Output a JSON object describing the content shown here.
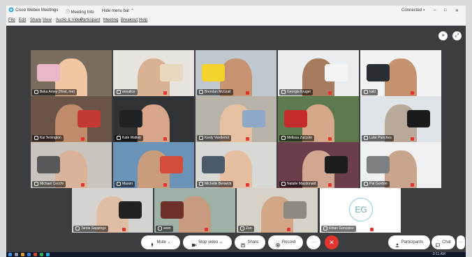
{
  "titlebar": {
    "app_title": "Cisco Webex Meetings",
    "meeting_info": "Meeting Info",
    "hide_menu_bar": "Hide menu bar",
    "status": "Connected",
    "minimize": "–",
    "maximize": "□",
    "close": "✕"
  },
  "menubar": [
    "File",
    "Edit",
    "Share",
    "View",
    "Audio & Video",
    "Participant",
    "Meeting",
    "Breakout",
    "Help"
  ],
  "participants": [
    {
      "name": "Beka Amey (Host, me)",
      "avatar": ""
    },
    {
      "name": "annalice",
      "avatar": ""
    },
    {
      "name": "Brendan McGrail",
      "avatar": ""
    },
    {
      "name": "Georgia Kruger",
      "avatar": ""
    },
    {
      "name": "kaki",
      "avatar": ""
    },
    {
      "name": "Kai Terrington",
      "avatar": ""
    },
    {
      "name": "Kate Walker",
      "avatar": ""
    },
    {
      "name": "Keely Vandertol",
      "avatar": ""
    },
    {
      "name": "Melissa Zuccolo",
      "avatar": ""
    },
    {
      "name": "Luke Punches",
      "avatar": ""
    },
    {
      "name": "Michael Cecchi",
      "avatar": ""
    },
    {
      "name": "Mason",
      "avatar": ""
    },
    {
      "name": "Michelle Benwick",
      "avatar": ""
    },
    {
      "name": "Natalie Macdonald",
      "avatar": ""
    },
    {
      "name": "Pat Gordon",
      "avatar": ""
    },
    {
      "name": "Tamia Sappings",
      "avatar": ""
    },
    {
      "name": "wom",
      "avatar": ""
    },
    {
      "name": "Zoe",
      "avatar": ""
    },
    {
      "name": "Ethan Gonzalez",
      "avatar": "EG"
    }
  ],
  "controls": {
    "mute": "Mute",
    "stop_video": "Stop video",
    "share": "Share",
    "record": "Record",
    "more": "···",
    "end": "✕",
    "participants": "Participants",
    "chat": "Chat",
    "more_right": "···"
  },
  "top_right": {
    "layout": "≡",
    "fullscreen": "⤢"
  },
  "taskbar": {
    "clock": "9:11 AM"
  },
  "colors": {
    "accent": "#2fb4d0",
    "end": "#e3342f",
    "stage": "#3b3d40"
  }
}
